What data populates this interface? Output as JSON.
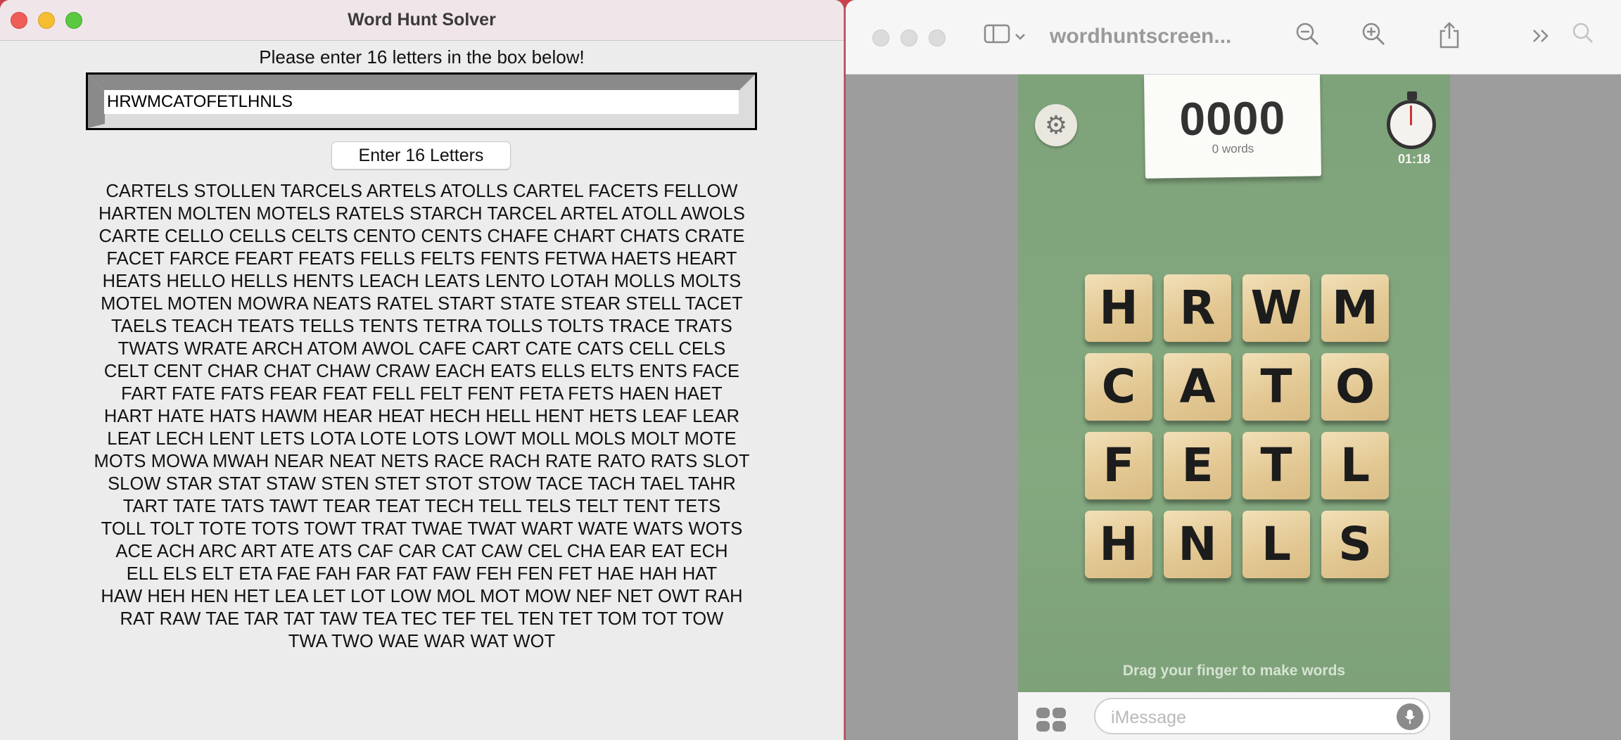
{
  "solver": {
    "window_title": "Word Hunt Solver",
    "prompt": "Please enter 16 letters in the box below!",
    "letters_value": "HRWMCATOFETLHNLS",
    "enter_button": "Enter 16 Letters",
    "results_lines": [
      "CARTELS STOLLEN TARCELS ARTELS ATOLLS CARTEL FACETS FELLOW",
      "HARTEN MOLTEN MOTELS RATELS STARCH TARCEL ARTEL ATOLL AWOLS",
      "CARTE CELLO CELLS CELTS CENTO CENTS CHAFE CHART CHATS CRATE",
      "FACET FARCE FEART FEATS FELLS FELTS FENTS FETWA HAETS HEART",
      "HEATS HELLO HELLS HENTS LEACH LEATS LENTO LOTAH MOLLS MOLTS",
      "MOTEL MOTEN MOWRA NEATS RATEL START STATE STEAR STELL TACET",
      "TAELS TEACH TEATS TELLS TENTS TETRA TOLLS TOLTS TRACE TRATS",
      "TWATS WRATE ARCH ATOM AWOL CAFE CART CATE CATS CELL CELS",
      "CELT CENT CHAR CHAT CHAW CRAW EACH EATS ELLS ELTS ENTS FACE",
      "FART FATE FATS FEAR FEAT FELL FELT FENT FETA FETS HAEN HAET",
      "HART HATE HATS HAWM HEAR HEAT HECH HELL HENT HETS LEAF LEAR",
      "LEAT LECH LENT LETS LOTA LOTE LOTS LOWT MOLL MOLS MOLT MOTE",
      "MOTS MOWA MWAH NEAR NEAT NETS RACE RACH RATE RATO RATS SLOT",
      "SLOW STAR STAT STAW STEN STET STOT STOW TACE TACH TAEL TAHR",
      "TART TATE TATS TAWT TEAR TEAT TECH TELL TELS TELT TENT TETS",
      "TOLL TOLT TOTE TOTS TOWT TRAT TWAE TWAT WART WATE WATS WOTS",
      "ACE ACH ARC ART ATE ATS CAF CAR CAT CAW CEL CHA EAR EAT ECH",
      "ELL ELS ELT ETA FAE FAH FAR FAT FAW FEH FEN FET HAE HAH HAT",
      "HAW HEH HEN HET LEA LET LOT LOW MOL MOT MOW NEF NET OWT RAH",
      "RAT RAW TAE TAR TAT TAW TEA TEC TEF TEL TEN TET TOM TOT TOW",
      "TWA TWO WAE WAR WAT WOT"
    ]
  },
  "preview": {
    "doc_title": "wordhuntscreen...",
    "toolbar_icons": [
      "sidebar-icon",
      "chevron-down-icon",
      "zoom-out-icon",
      "zoom-in-icon",
      "share-icon",
      "more-icon",
      "search-icon"
    ],
    "game": {
      "score": "0000",
      "word_count": "0 words",
      "timer": "01:18",
      "tiles": [
        "H",
        "R",
        "W",
        "M",
        "C",
        "A",
        "T",
        "O",
        "F",
        "E",
        "T",
        "L",
        "H",
        "N",
        "L",
        "S"
      ],
      "hint": "Drag your finger to make words",
      "message_placeholder": "iMessage"
    }
  },
  "colors": {
    "board_green": "#82a67d",
    "tile_wood": "#e6cb96",
    "solver_bg": "#ececec"
  }
}
